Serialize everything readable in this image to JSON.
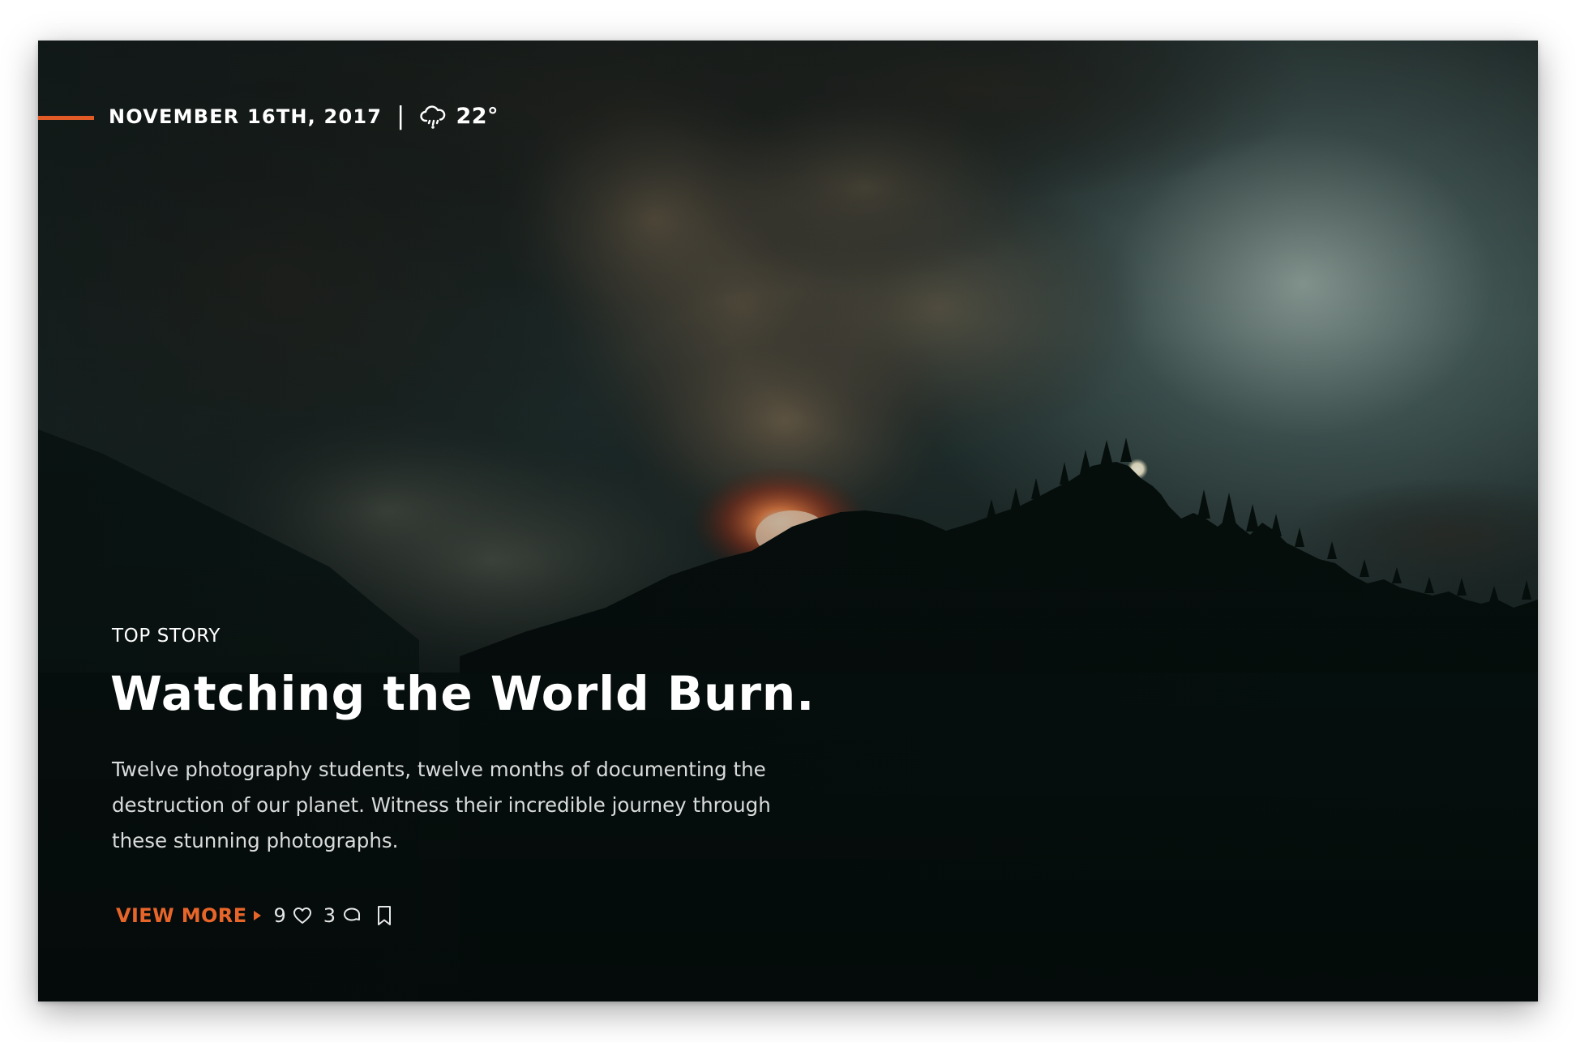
{
  "meta": {
    "date": "NOVEMBER 16TH, 2017",
    "separator": "|",
    "weather_icon": "cloud-rain-icon",
    "temperature": "22°"
  },
  "story": {
    "kicker": "TOP STORY",
    "headline": "Watching the World Burn.",
    "dek": "Twelve photography students, twelve months of documenting the destruction of our planet. Witness their incredible journey through these stunning photographs."
  },
  "actions": {
    "view_more_label": "VIEW MORE",
    "likes": "9",
    "comments": "3",
    "like_icon": "heart-icon",
    "comment_icon": "comment-icon",
    "bookmark_icon": "bookmark-icon"
  },
  "colors": {
    "accent": "#e25a26",
    "link": "#e8652a",
    "text": "#ffffff"
  }
}
